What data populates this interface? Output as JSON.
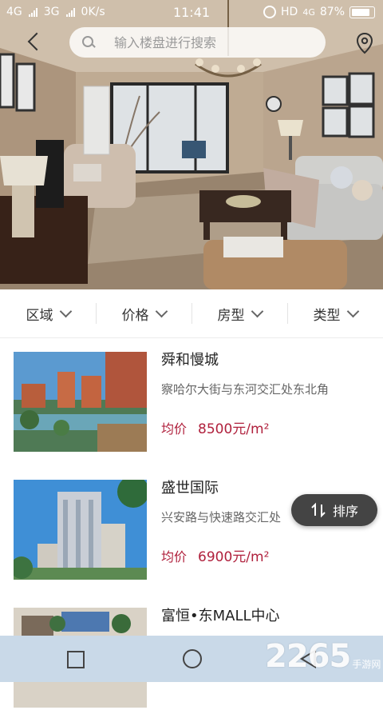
{
  "status_bar": {
    "network_1": "4G",
    "network_2": "3G",
    "speed": "0K/s",
    "time": "11:41",
    "hd_label": "HD",
    "network_3": "4G",
    "battery": "87%"
  },
  "header": {
    "search_placeholder": "输入楼盘进行搜索",
    "back_icon": "chevron-left-icon",
    "location_icon": "location-pin-icon"
  },
  "filters": [
    {
      "label": "区域"
    },
    {
      "label": "价格"
    },
    {
      "label": "房型"
    },
    {
      "label": "类型"
    }
  ],
  "listings": [
    {
      "name": "舜和慢城",
      "address": "察哈尔大街与东河交汇处东北角",
      "price_label": "均价",
      "price": "8500元/m²"
    },
    {
      "name": "盛世国际",
      "address": "兴安路与快速路交汇处",
      "price_label": "均价",
      "price": "6900元/m²"
    },
    {
      "name": "富恒•东MALL中心",
      "address": "",
      "price_label": "",
      "price": ""
    }
  ],
  "sort_button": {
    "label": "排序",
    "icon": "sort-arrows-icon"
  },
  "watermark": {
    "brand": "2265",
    "sub": "手游网"
  },
  "colors": {
    "price": "#b0213d",
    "sort_bg": "#444444",
    "navbar_bg": "#c9d9e8"
  }
}
